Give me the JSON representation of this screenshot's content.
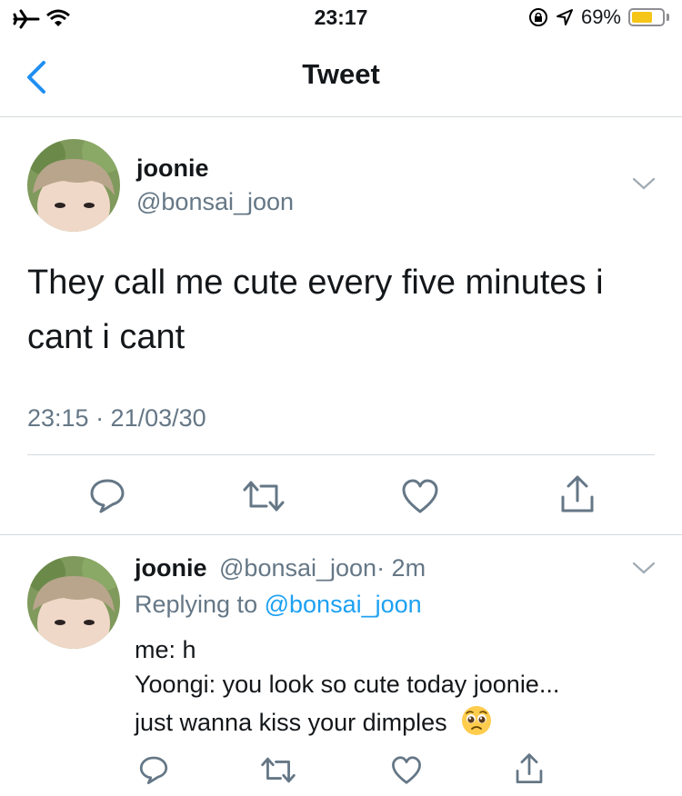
{
  "status_bar": {
    "time": "23:17",
    "battery_text": "69%",
    "battery_level": 0.69,
    "icons": [
      "airplane-icon",
      "wifi-icon",
      "rotation-lock-icon",
      "location-icon",
      "battery-icon"
    ]
  },
  "nav": {
    "title": "Tweet",
    "back_icon": "chevron-left-icon"
  },
  "tweet": {
    "name": "joonie",
    "handle": "@bonsai_joon",
    "text_line1": "They call me cute every five minutes i",
    "text_line2": "cant i cant",
    "timestamp": "23:15 · 21/03/30",
    "actions": [
      "reply-icon",
      "retweet-icon",
      "like-icon",
      "share-icon"
    ]
  },
  "reply": {
    "name": "joonie",
    "handle": "@bonsai_joon",
    "time": "· 2m",
    "replying_prefix": "Replying to",
    "replying_handle": "@bonsai_joon",
    "line1": "me: h",
    "line2": "Yoongi: you look so cute today joonie...",
    "line3": "just wanna kiss your dimples",
    "emoji": "pleading-face-emoji",
    "actions": [
      "reply-icon",
      "retweet-icon",
      "like-icon",
      "share-icon"
    ]
  },
  "colors": {
    "accent": "#1da1f2",
    "back": "#1f8ff2",
    "text": "#14171a",
    "muted": "#657786",
    "icon": "#657786",
    "divider": "#d5d9dc",
    "battery": "#f5c518"
  }
}
